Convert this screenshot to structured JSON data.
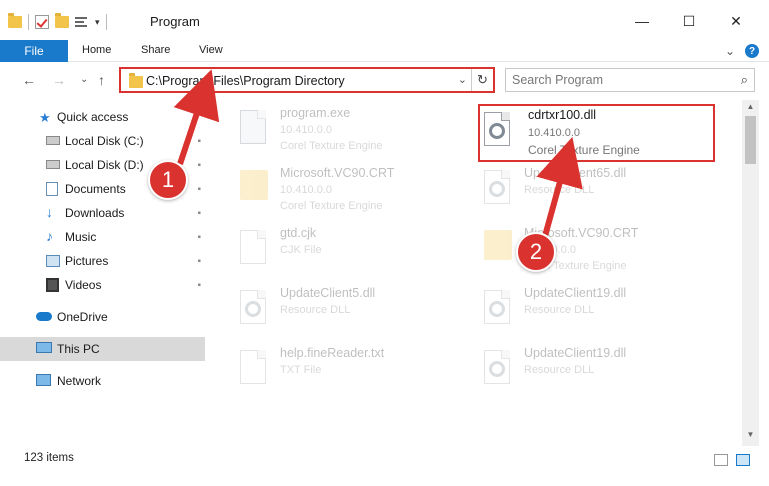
{
  "window": {
    "title": "Program",
    "minimize_glyph": "—",
    "maximize_glyph": "☐",
    "close_glyph": "✕"
  },
  "ribbon": {
    "file": "File",
    "tabs": [
      "Home",
      "Share",
      "View"
    ],
    "collapse_glyph": "⌄",
    "help": "?"
  },
  "nav": {
    "back": "←",
    "forward": "→",
    "recent": "⌄",
    "up": "↑"
  },
  "address": {
    "path": "C:\\Program Files\\Program Directory",
    "dropdown": "⌄",
    "refresh": "↻"
  },
  "search": {
    "placeholder": "Search Program",
    "icon": "⌕"
  },
  "sidebar": {
    "items": [
      {
        "label": "Quick access",
        "icon": "star-icon",
        "pinned": false
      },
      {
        "label": "Local Disk (C:)",
        "icon": "drive-icon",
        "pinned": true
      },
      {
        "label": "Local Disk (D:)",
        "icon": "drive-icon",
        "pinned": true
      },
      {
        "label": "Documents",
        "icon": "documents-icon",
        "pinned": true
      },
      {
        "label": "Downloads",
        "icon": "downloads-icon",
        "pinned": true
      },
      {
        "label": "Music",
        "icon": "music-icon",
        "pinned": true
      },
      {
        "label": "Pictures",
        "icon": "pictures-icon",
        "pinned": true
      },
      {
        "label": "Videos",
        "icon": "videos-icon",
        "pinned": true
      },
      {
        "label": "OneDrive",
        "icon": "cloud-icon",
        "pinned": false
      },
      {
        "label": "This PC",
        "icon": "pc-icon",
        "pinned": false,
        "selected": true
      },
      {
        "label": "Network",
        "icon": "network-icon",
        "pinned": false
      }
    ],
    "pin_glyph": "📌"
  },
  "files": [
    {
      "name": "program.exe",
      "version": "10.410.0.0",
      "description": "Corel Texture Engine",
      "icon": "exe-icon",
      "faded": true
    },
    {
      "name": "cdrtxr100.dll",
      "version": "10.410.0.0",
      "description": "Corel Texture Engine",
      "icon": "dll-gear-icon",
      "faded": false,
      "highlighted": true
    },
    {
      "name": "Microsoft.VC90.CRT",
      "version": "10.410.0.0",
      "description": "Corel Texture Engine",
      "icon": "folder-icon",
      "faded": true
    },
    {
      "name": "UpdateClient65.dll",
      "version": "Resource DLL",
      "description": "",
      "icon": "dll-gear-icon",
      "faded": true
    },
    {
      "name": "gtd.cjk",
      "version": "CJK File",
      "description": "",
      "icon": "file-icon",
      "faded": true
    },
    {
      "name": "Microsoft.VC90.CRT",
      "version": "10.410.0.0",
      "description": "Corel Texture Engine",
      "icon": "folder-icon",
      "faded": true
    },
    {
      "name": "UpdateClient5.dll",
      "version": "Resource DLL",
      "description": "",
      "icon": "dll-gear-icon",
      "faded": true
    },
    {
      "name": "UpdateClient19.dll",
      "version": "Resource DLL",
      "description": "",
      "icon": "dll-gear-icon",
      "faded": true
    },
    {
      "name": "help.fineReader.txt",
      "version": "TXT File",
      "description": "",
      "icon": "file-icon",
      "faded": true
    },
    {
      "name": "UpdateClient19.dll",
      "version": "Resource DLL",
      "description": "",
      "icon": "dll-gear-icon",
      "faded": true
    }
  ],
  "status": {
    "count": "123 items"
  },
  "annotations": {
    "step1": "1",
    "step2": "2",
    "color": "#d9322f"
  }
}
